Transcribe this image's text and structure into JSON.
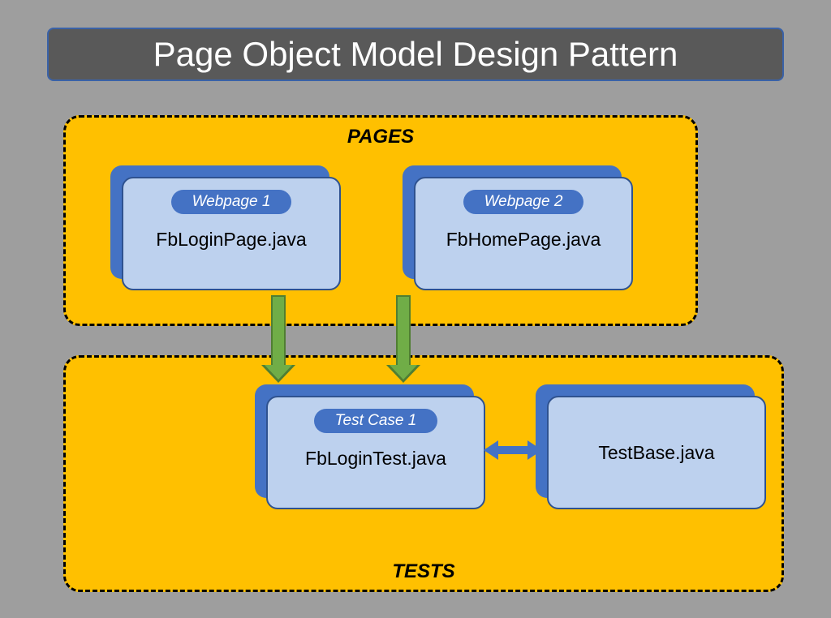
{
  "title": "Page Object Model Design Pattern",
  "sections": {
    "pages": {
      "label": "PAGES"
    },
    "tests": {
      "label": "TESTS"
    }
  },
  "cards": {
    "webpage1": {
      "pill": "Webpage 1",
      "text": "FbLoginPage.java"
    },
    "webpage2": {
      "pill": "Webpage 2",
      "text": "FbHomePage.java"
    },
    "testcase1": {
      "pill": "Test Case 1",
      "text": "FbLoginTest.java"
    },
    "testbase": {
      "text": "TestBase.java"
    }
  },
  "colors": {
    "background": "#9e9e9e",
    "title_bg": "#595959",
    "title_border": "#3a62a8",
    "section_bg": "#ffc000",
    "card_shadow": "#4472c4",
    "card_front": "#bdd1ee",
    "card_border": "#2f528f",
    "arrow_green": "#70ad47",
    "arrow_green_outline": "#507e32",
    "arrow_blue": "#4472c4"
  }
}
